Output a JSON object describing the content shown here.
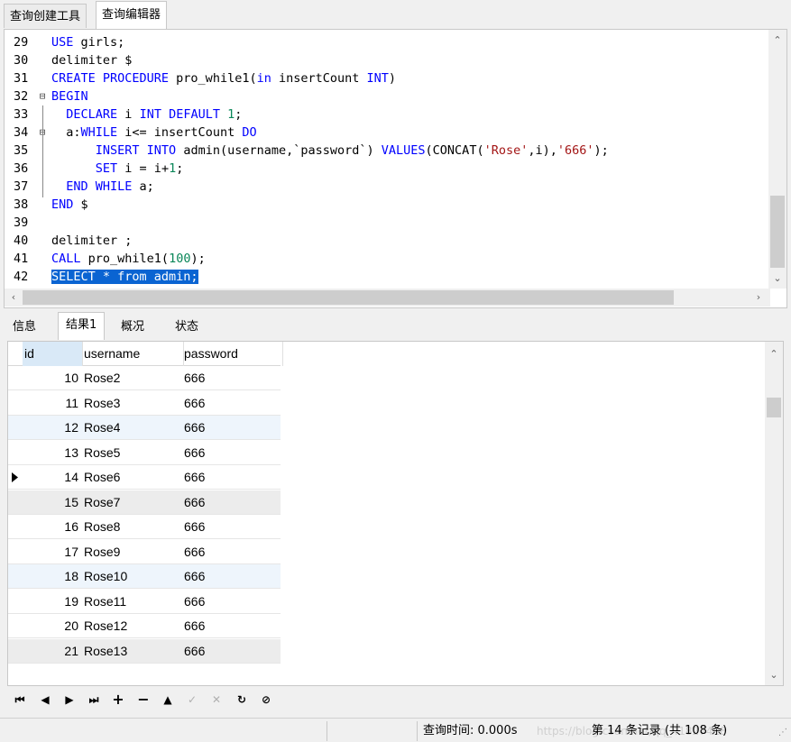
{
  "tabs": [
    "查询创建工具",
    "查询编辑器"
  ],
  "editor": {
    "lines": [
      {
        "n": "29",
        "fold": "",
        "parts": [
          [
            "kw",
            "USE"
          ],
          [
            "t",
            " girls;"
          ]
        ]
      },
      {
        "n": "30",
        "fold": "",
        "parts": [
          [
            "t",
            "delimiter $"
          ]
        ]
      },
      {
        "n": "31",
        "fold": "",
        "parts": [
          [
            "kw",
            "CREATE PROCEDURE"
          ],
          [
            "t",
            " pro_while1("
          ],
          [
            "kw",
            "in"
          ],
          [
            "t",
            " insertCount "
          ],
          [
            "kw",
            "INT"
          ],
          [
            "t",
            ")"
          ]
        ]
      },
      {
        "n": "32",
        "fold": "⊟",
        "parts": [
          [
            "kw",
            "BEGIN"
          ]
        ]
      },
      {
        "n": "33",
        "fold": "",
        "parts": [
          [
            "t",
            "  "
          ],
          [
            "kw",
            "DECLARE"
          ],
          [
            "t",
            " i "
          ],
          [
            "kw",
            "INT DEFAULT"
          ],
          [
            "t",
            " "
          ],
          [
            "num",
            "1"
          ],
          [
            "t",
            ";"
          ]
        ]
      },
      {
        "n": "34",
        "fold": "⊟",
        "parts": [
          [
            "t",
            "  a:"
          ],
          [
            "kw",
            "WHILE"
          ],
          [
            "t",
            " i<= insertCount "
          ],
          [
            "kw",
            "DO"
          ]
        ]
      },
      {
        "n": "35",
        "fold": "",
        "parts": [
          [
            "t",
            "      "
          ],
          [
            "kw",
            "INSERT INTO"
          ],
          [
            "t",
            " admin(username,`password`) "
          ],
          [
            "kw",
            "VALUES"
          ],
          [
            "t",
            "(CONCAT("
          ],
          [
            "str",
            "'Rose'"
          ],
          [
            "t",
            ",i),"
          ],
          [
            "str",
            "'666'"
          ],
          [
            "t",
            ");"
          ]
        ]
      },
      {
        "n": "36",
        "fold": "",
        "parts": [
          [
            "t",
            "      "
          ],
          [
            "kw",
            "SET"
          ],
          [
            "t",
            " i = i+"
          ],
          [
            "num",
            "1"
          ],
          [
            "t",
            ";"
          ]
        ]
      },
      {
        "n": "37",
        "fold": "",
        "parts": [
          [
            "t",
            "  "
          ],
          [
            "kw",
            "END WHILE"
          ],
          [
            "t",
            " a;"
          ]
        ]
      },
      {
        "n": "38",
        "fold": "",
        "parts": [
          [
            "kw",
            "END"
          ],
          [
            "t",
            " $"
          ]
        ]
      },
      {
        "n": "39",
        "fold": "",
        "parts": []
      },
      {
        "n": "40",
        "fold": "",
        "parts": [
          [
            "t",
            "delimiter ;"
          ]
        ]
      },
      {
        "n": "41",
        "fold": "",
        "parts": [
          [
            "kw",
            "CALL"
          ],
          [
            "t",
            " pro_while1("
          ],
          [
            "num",
            "100"
          ],
          [
            "t",
            ");"
          ]
        ]
      },
      {
        "n": "42",
        "fold": "",
        "parts": [
          [
            "sel",
            "SELECT * from admin;"
          ]
        ]
      }
    ]
  },
  "result_tabs": [
    "信息",
    "结果1",
    "概况",
    "状态"
  ],
  "grid": {
    "columns": [
      "id",
      "username",
      "password"
    ],
    "rows": [
      [
        "10",
        "Rose2",
        "666"
      ],
      [
        "11",
        "Rose3",
        "666"
      ],
      [
        "12",
        "Rose4",
        "666"
      ],
      [
        "13",
        "Rose5",
        "666"
      ],
      [
        "14",
        "Rose6",
        "666"
      ],
      [
        "15",
        "Rose7",
        "666"
      ],
      [
        "16",
        "Rose8",
        "666"
      ],
      [
        "17",
        "Rose9",
        "666"
      ],
      [
        "18",
        "Rose10",
        "666"
      ],
      [
        "19",
        "Rose11",
        "666"
      ],
      [
        "20",
        "Rose12",
        "666"
      ],
      [
        "21",
        "Rose13",
        "666"
      ]
    ]
  },
  "navbar": [
    "first-record-icon",
    "prev-record-icon",
    "next-record-icon",
    "last-record-icon",
    "add-record-icon",
    "delete-record-icon",
    "edit-up-icon",
    "apply-check-icon",
    "discard-x-icon",
    "refresh-icon",
    "stop-icon"
  ],
  "status": {
    "query_time": "查询时间: 0.000s",
    "record": "第 14 条记录 (共 108 条)",
    "watermark": "https://blog.csdn.net/qq_41827418"
  }
}
